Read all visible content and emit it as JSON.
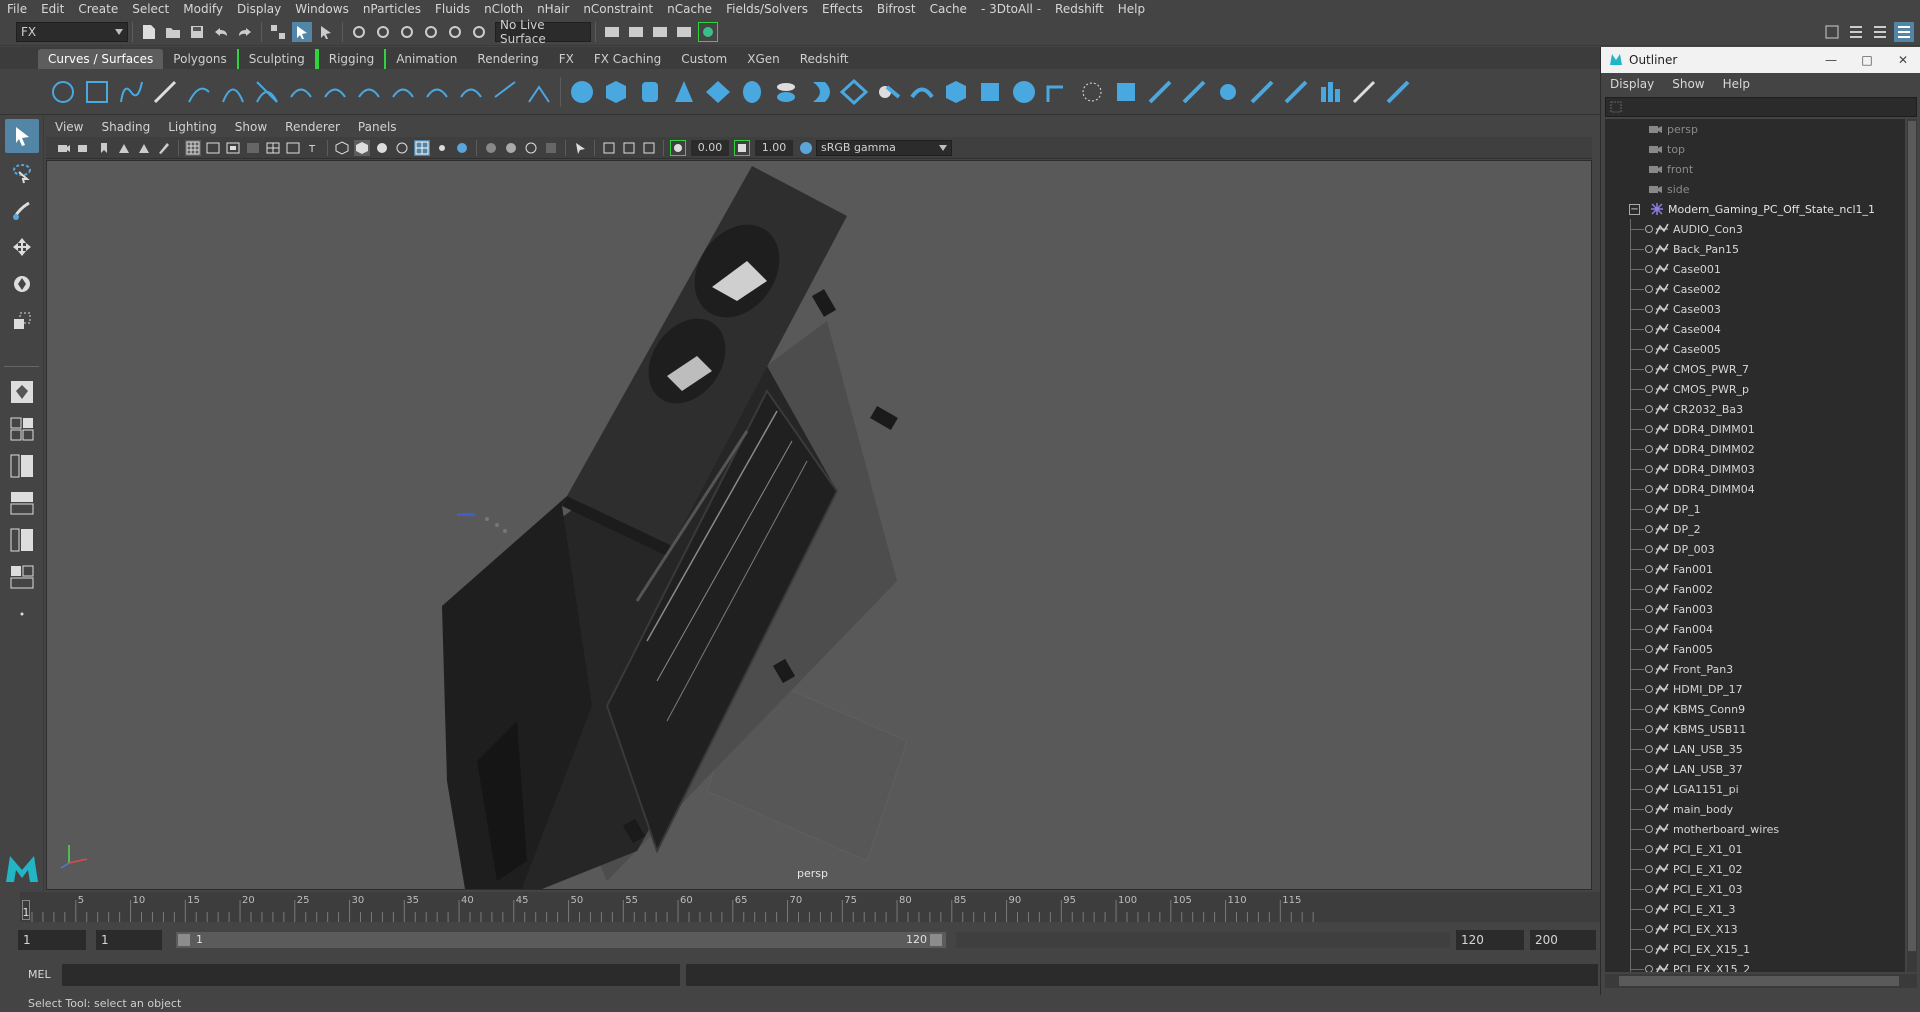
{
  "menubar": [
    "File",
    "Edit",
    "Create",
    "Select",
    "Modify",
    "Display",
    "Windows",
    "nParticles",
    "Fluids",
    "nCloth",
    "nHair",
    "nConstraint",
    "nCache",
    "Fields/Solvers",
    "Effects",
    "Bifrost",
    "Cache",
    "- 3DtoAll -",
    "Redshift",
    "Help"
  ],
  "status": {
    "menuset": "FX",
    "live_surface": "No Live Surface"
  },
  "shelf_tabs": [
    "Curves / Surfaces",
    "Polygons",
    "Sculpting",
    "Rigging",
    "Animation",
    "Rendering",
    "FX",
    "FX Caching",
    "Custom",
    "XGen",
    "Redshift"
  ],
  "panel_menu": [
    "View",
    "Shading",
    "Lighting",
    "Show",
    "Renderer",
    "Panels"
  ],
  "panel_tools": {
    "exposure": "0.00",
    "gamma": "1.00",
    "colorspace": "sRGB gamma"
  },
  "viewport": {
    "camera_label": "persp"
  },
  "timeline": {
    "ticks": [
      "5",
      "10",
      "15",
      "20",
      "25",
      "30",
      "35",
      "40",
      "45",
      "50",
      "55",
      "60",
      "65",
      "70",
      "75",
      "80",
      "85",
      "90",
      "95",
      "100",
      "105",
      "110",
      "115"
    ],
    "current_frame": "1"
  },
  "range": {
    "start": "1",
    "playback_start": "1",
    "slider_start": "1",
    "slider_end": "120",
    "playback_end": "120",
    "end": "200"
  },
  "cmdline": {
    "label": "MEL"
  },
  "helpline": "Select Tool: select an object",
  "outliner": {
    "title": "Outliner",
    "menu": [
      "Display",
      "Show",
      "Help"
    ],
    "cameras": [
      "persp",
      "top",
      "front",
      "side"
    ],
    "group": "Modern_Gaming_PC_Off_State_ncl1_1",
    "children": [
      "AUDIO_Con3",
      "Back_Pan15",
      "Case001",
      "Case002",
      "Case003",
      "Case004",
      "Case005",
      "CMOS_PWR_7",
      "CMOS_PWR_p",
      "CR2032_Ba3",
      "DDR4_DIMM01",
      "DDR4_DIMM02",
      "DDR4_DIMM03",
      "DDR4_DIMM04",
      "DP_1",
      "DP_2",
      "DP_003",
      "Fan001",
      "Fan002",
      "Fan003",
      "Fan004",
      "Fan005",
      "Front_Pan3",
      "HDMI_DP_17",
      "KBMS_Conn9",
      "KBMS_USB11",
      "LAN_USB_35",
      "LAN_USB_37",
      "LGA1151_pi",
      "main_body",
      "motherboard_wires",
      "PCI_E_X1_01",
      "PCI_E_X1_02",
      "PCI_E_X1_03",
      "PCI_E_X1_3",
      "PCI_EX_X13",
      "PCI_EX_X15_1",
      "PCI_EX_X15_2"
    ]
  },
  "colors": {
    "accent_blue": "#5285a6",
    "shelf_blue": "#4aa8e0",
    "bracket_green": "#2fd33a"
  }
}
